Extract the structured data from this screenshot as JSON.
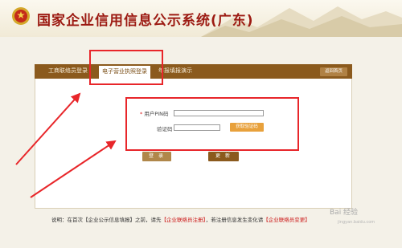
{
  "header": {
    "title": "国家企业信用信息公示系统(广东)"
  },
  "tabs": [
    {
      "label": "工商联络员登录"
    },
    {
      "label": "电子营业执照登录"
    },
    {
      "label": "年报填报演示"
    }
  ],
  "home_button": "返回首页",
  "form": {
    "pin_label": "用户PIN码",
    "captcha_label": "验证码",
    "captcha_button": "获取验证码"
  },
  "buttons": {
    "login": "登 录",
    "reset": "更 新"
  },
  "footer": {
    "prefix": "说明：在首次【企业公示信息填报】之前，请先",
    "link1": "【企业联络员注册】",
    "middle": "，若注册信息发生变化请",
    "link2": "【企业联络员变更】"
  },
  "watermark": {
    "text": "Bai 经验",
    "sub": "jingyan.baidu.com"
  },
  "colors": {
    "title_red": "#9c1a12",
    "tab_brown": "#8b5a1d",
    "annotation_red": "#e8262a",
    "captcha_orange": "#e8a13c"
  }
}
